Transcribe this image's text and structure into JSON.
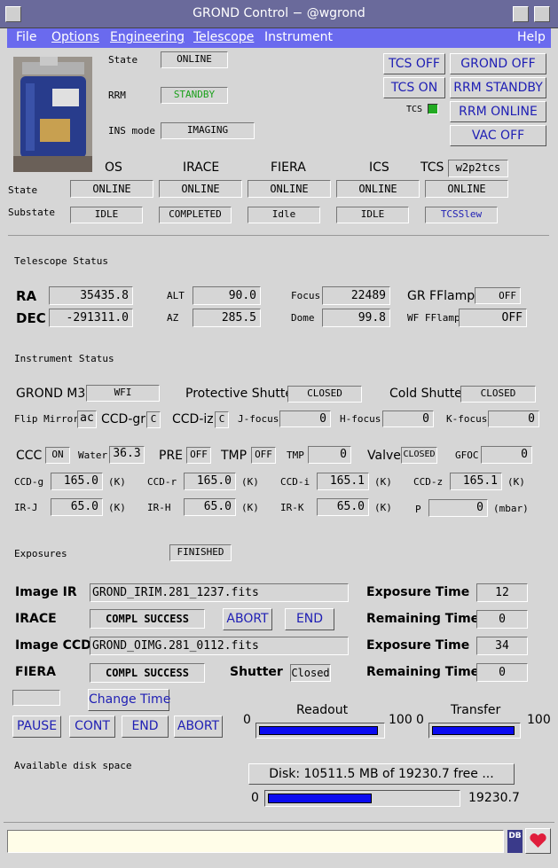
{
  "window": {
    "title": "GROND Control − @wgrond"
  },
  "menu": {
    "file": "File",
    "options": "Options",
    "engineering": "Engineering",
    "telescope": "Telescope",
    "instrument": "Instrument",
    "help": "Help"
  },
  "top": {
    "state_label": "State",
    "state_value": "ONLINE",
    "rrm_label": "RRM",
    "rrm_value": "STANDBY",
    "insmode_label": "INS mode",
    "insmode_value": "IMAGING",
    "tcs_indicator_label": "TCS",
    "buttons": {
      "tcs_off": "TCS OFF",
      "tcs_on": "TCS ON",
      "grond_off": "GROND OFF",
      "rrm_standby": "RRM STANDBY",
      "rrm_online": "RRM ONLINE",
      "vac_off": "VAC OFF"
    }
  },
  "subsystems": {
    "headers": [
      "OS",
      "IRACE",
      "FIERA",
      "ICS",
      "TCS"
    ],
    "tcs_host": "w2p2tcs",
    "state_label": "State",
    "substate_label": "Substate",
    "states": [
      "ONLINE",
      "ONLINE",
      "ONLINE",
      "ONLINE",
      "ONLINE"
    ],
    "substates": [
      "IDLE",
      "COMPLETED",
      "Idle",
      "IDLE",
      "TCSSlew"
    ]
  },
  "telescope": {
    "section": "Telescope Status",
    "ra_label": "RA",
    "ra": "35435.8",
    "dec_label": "DEC",
    "dec": "-291311.0",
    "alt_label": "ALT",
    "alt": "90.0",
    "az_label": "AZ",
    "az": "285.5",
    "focus_label": "Focus",
    "focus": "22489",
    "dome_label": "Dome",
    "dome": "99.8",
    "grff_label": "GR FFlamp",
    "grff": "OFF",
    "wfff_label": "WF FFlamp",
    "wfff": "OFF"
  },
  "instrument": {
    "section": "Instrument Status",
    "m3_label": "GROND M3",
    "m3": "WFI",
    "pshutter_label": "Protective Shutter",
    "pshutter": "CLOSED",
    "cshutter_label": "Cold Shutter",
    "cshutter": "CLOSED",
    "flip_label": "Flip Mirror",
    "flip": "ac",
    "ccdgr_label": "CCD-gr",
    "ccdgr": "C",
    "ccdiz_label": "CCD-iz",
    "ccdiz": "C",
    "jfocus_label": "J-focus",
    "jfocus": "0",
    "hfocus_label": "H-focus",
    "hfocus": "0",
    "kfocus_label": "K-focus",
    "kfocus": "0",
    "ccc_label": "CCC",
    "ccc": "ON",
    "water_label": "Water",
    "water": "36.3",
    "pre_label": "PRE",
    "pre": "OFF",
    "tmp_label": "TMP",
    "tmp": "OFF",
    "tmp2_label": "TMP",
    "tmp2": "0",
    "valve_label": "Valve",
    "valve": "CLOSED",
    "gfoc_label": "GFOC",
    "gfoc": "0",
    "ccd_g_label": "CCD-g",
    "ccd_g": "165.0",
    "ccd_r_label": "CCD-r",
    "ccd_r": "165.0",
    "ccd_i_label": "CCD-i",
    "ccd_i": "165.1",
    "ccd_z_label": "CCD-z",
    "ccd_z": "165.1",
    "ir_j_label": "IR-J",
    "ir_j": "65.0",
    "ir_h_label": "IR-H",
    "ir_h": "65.0",
    "ir_k_label": "IR-K",
    "ir_k": "65.0",
    "p_label": "P",
    "p": "0",
    "unit_k": "(K)",
    "unit_mbar": "(mbar)"
  },
  "exposures": {
    "section": "Exposures",
    "status": "FINISHED",
    "image_ir_label": "Image IR",
    "image_ir": "GROND_IRIM.281_1237.fits",
    "irace_label": "IRACE",
    "irace_status": "COMPL SUCCESS",
    "image_ccd_label": "Image CCD",
    "image_ccd": "GROND_OIMG.281_0112.fits",
    "fiera_label": "FIERA",
    "fiera_status": "COMPL SUCCESS",
    "exptime_label": "Exposure Time",
    "exptime_ir": "12",
    "exptime_ccd": "34",
    "remtime_label": "Remaining Time",
    "remtime_ir": "0",
    "remtime_ccd": "0",
    "shutter_label": "Shutter",
    "shutter": "Closed",
    "abort": "ABORT",
    "end": "END",
    "change_time": "Change Time",
    "pause": "PAUSE",
    "cont": "CONT",
    "end2": "END",
    "abort2": "ABORT",
    "readout_label": "Readout",
    "readout_min": "0",
    "readout_max": "100",
    "readout_fraction": 0.97,
    "transfer_label": "Transfer",
    "transfer_min": "0",
    "transfer_max": "100",
    "transfer_fraction": 0.97
  },
  "disk": {
    "label": "Available disk space",
    "button": "Disk: 10511.5 MB of 19230.7 free ...",
    "min": "0",
    "max": "19230.7",
    "used_fraction": 0.547
  },
  "statusbar": {
    "db_icon_text": "DB"
  }
}
